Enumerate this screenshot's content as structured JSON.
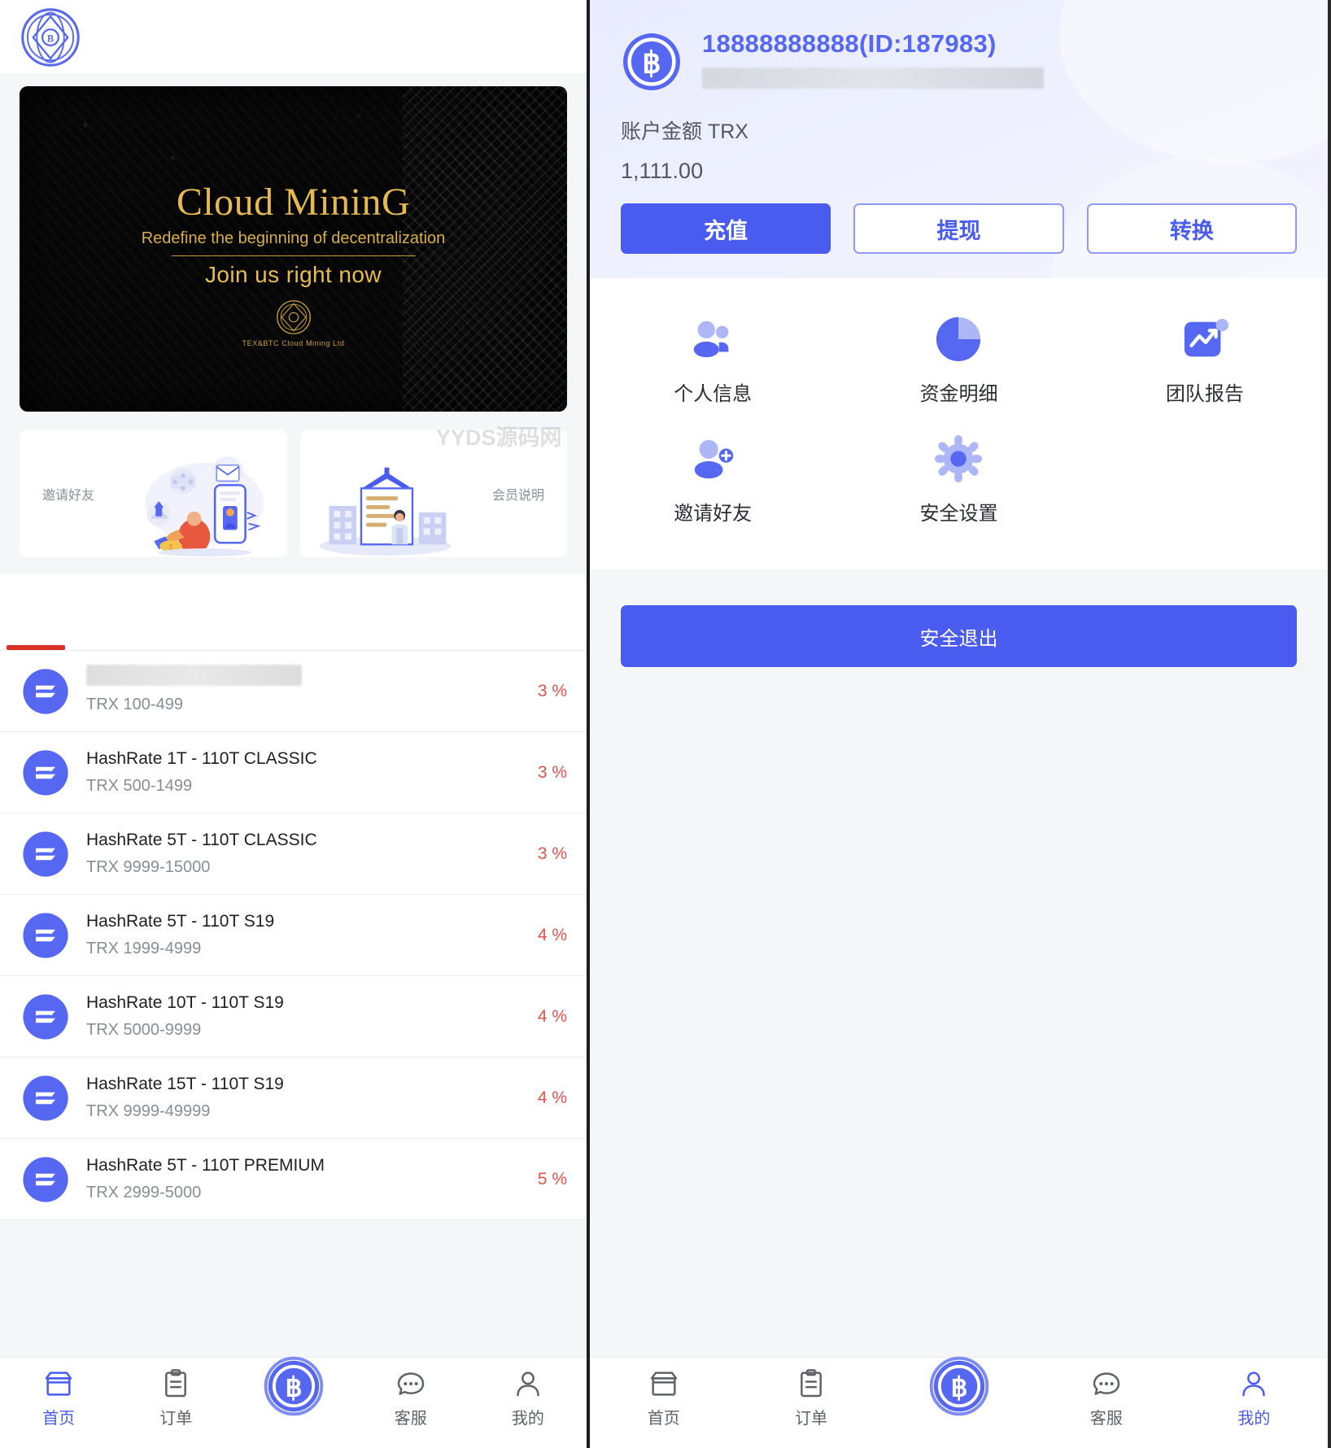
{
  "home": {
    "brand_icon": "brand-diamond-logo-icon",
    "banner": {
      "title": "Cloud MininG",
      "subtitle": "Redefine the beginning of decentralization",
      "cta": "Join us right now",
      "mark_caption": "TEX&BTC Cloud Mining Ltd"
    },
    "promos": [
      {
        "label": "邀请好友",
        "art": "invite-friends-illustration"
      },
      {
        "label": "会员说明",
        "art": "membership-guide-illustration"
      }
    ],
    "watermark": "YYDS源码网",
    "products": [
      {
        "title": "",
        "redacted": true,
        "range": "TRX 100-499",
        "rate": "3 %"
      },
      {
        "title": "HashRate 1T - 110T CLASSIC",
        "redacted": false,
        "range": "TRX 500-1499",
        "rate": "3 %"
      },
      {
        "title": "HashRate 5T - 110T CLASSIC",
        "redacted": false,
        "range": "TRX 9999-15000",
        "rate": "3 %"
      },
      {
        "title": "HashRate 5T - 110T S19",
        "redacted": false,
        "range": "TRX 1999-4999",
        "rate": "4 %"
      },
      {
        "title": "HashRate 10T - 110T S19",
        "redacted": false,
        "range": "TRX 5000-9999",
        "rate": "4 %"
      },
      {
        "title": "HashRate 15T - 110T S19",
        "redacted": false,
        "range": "TRX 9999-49999",
        "rate": "4 %"
      },
      {
        "title": "HashRate 5T - 110T PREMIUM",
        "redacted": false,
        "range": "TRX 2999-5000",
        "rate": "5 %"
      }
    ]
  },
  "profile": {
    "account_id": "18888888888(ID:187983)",
    "balance_label": "账户金额 TRX",
    "balance_value": "1,111.00",
    "actions": [
      {
        "label": "充值",
        "style": "primary"
      },
      {
        "label": "提现",
        "style": "ghost"
      },
      {
        "label": "转换",
        "style": "ghost"
      }
    ],
    "features": [
      {
        "label": "个人信息",
        "icon": "users-icon"
      },
      {
        "label": "资金明细",
        "icon": "pie-chart-icon"
      },
      {
        "label": "团队报告",
        "icon": "chart-line-card-icon"
      },
      {
        "label": "邀请好友",
        "icon": "user-plus-icon"
      },
      {
        "label": "安全设置",
        "icon": "gear-icon"
      }
    ],
    "logout_label": "安全退出"
  },
  "nav": {
    "items": [
      {
        "label": "首页",
        "icon": "home-store-icon"
      },
      {
        "label": "订单",
        "icon": "orders-clipboard-icon"
      },
      {
        "label": "",
        "icon": "bitcoin-center-icon"
      },
      {
        "label": "客服",
        "icon": "chat-support-icon"
      },
      {
        "label": "我的",
        "icon": "user-profile-icon"
      }
    ],
    "left_active_index": 0,
    "right_active_index": 4
  },
  "colors": {
    "accent": "#4a5cf0",
    "rate": "#e0524a",
    "gold": "#e5b94e",
    "tab_underline": "#d93025"
  }
}
